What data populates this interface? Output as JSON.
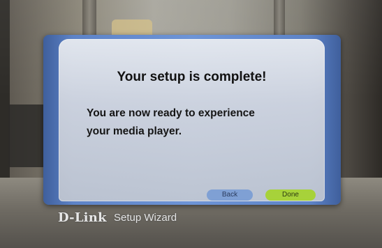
{
  "dialog": {
    "title": "Your setup is complete!",
    "message_line1": "You are now ready to experience",
    "message_line2": "your media player."
  },
  "buttons": {
    "back": "Back",
    "done": "Done"
  },
  "footer": {
    "brand": "D-Link",
    "wizard": "Setup Wizard"
  },
  "colors": {
    "frame_blue": "#5d83c7",
    "back_button": "#7fa0d4",
    "done_button": "#a7d23a"
  }
}
